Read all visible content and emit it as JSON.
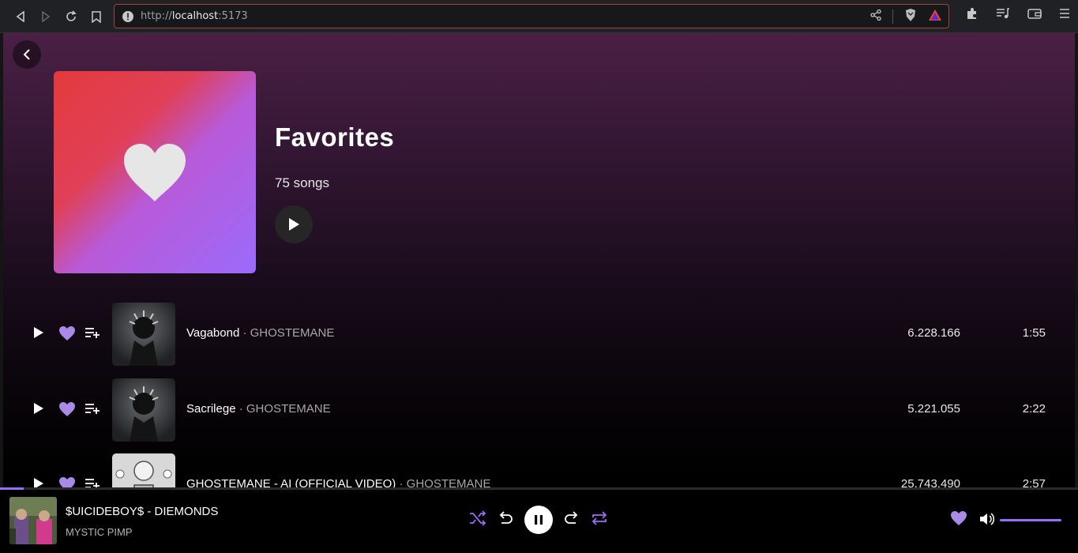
{
  "browser": {
    "url_scheme": "http://",
    "url_host": "localhost",
    "url_port": ":5173"
  },
  "playlist": {
    "title": "Favorites",
    "song_count": "75 songs",
    "accent_color": "#9b6bfa"
  },
  "tracks": [
    {
      "title": "Vagabond",
      "artist": "GHOSTEMANE",
      "plays": "6.228.166",
      "duration": "1:55",
      "liked": true
    },
    {
      "title": "Sacrilege",
      "artist": "GHOSTEMANE",
      "plays": "5.221.055",
      "duration": "2:22",
      "liked": true
    },
    {
      "title": "GHOSTEMANE - AI (OFFICIAL VIDEO)",
      "artist": "GHOSTEMANE",
      "plays": "25.743.490",
      "duration": "2:57",
      "liked": true
    }
  ],
  "separator": " · ",
  "now_playing": {
    "title": "$UICIDEBOY$ - DIEMONDS",
    "artist": "MYSTIC PIMP",
    "progress": 0.022,
    "volume": 1.0,
    "liked": true
  }
}
